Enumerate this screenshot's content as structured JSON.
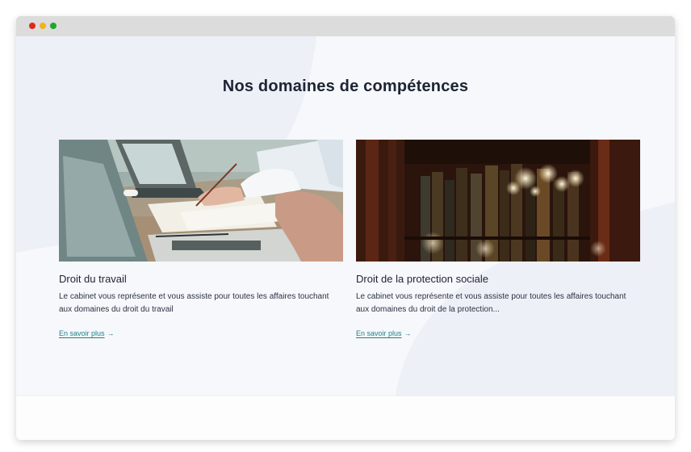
{
  "window_controls": [
    "close",
    "minimize",
    "maximize"
  ],
  "section": {
    "title": "Nos domaines de compétences"
  },
  "cards": [
    {
      "image": "office-meeting-laptop-documents-photo",
      "title": "Droit du travail",
      "text": "Le cabinet vous représente et vous assiste pour toutes les affaires touchant aux domaines du droit du travail",
      "link_label": "En savoir plus",
      "link_icon": "arrow-right-icon"
    },
    {
      "image": "law-library-bookshelf-photo",
      "title": "Droit de la protection sociale",
      "text": "Le cabinet vous représente et vous assiste pour toutes les affaires touchant aux domaines du droit de la protection...",
      "link_label": "En savoir plus",
      "link_icon": "arrow-right-icon"
    }
  ],
  "colors": {
    "titlebar": "#dcdcdc",
    "background": "#f5f7fb",
    "heading": "#1d2433",
    "link": "#1f7f86"
  }
}
